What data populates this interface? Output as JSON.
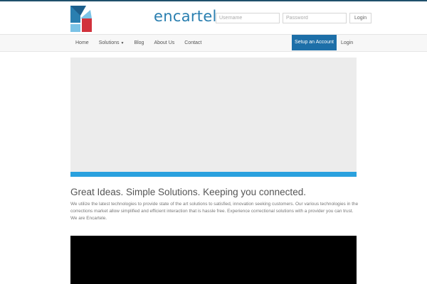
{
  "brand": {
    "name_en": "en",
    "name_rest": "cartele",
    "color_blue": "#2a7fb0",
    "color_red": "#d1323c",
    "color_light": "#7bc3e6"
  },
  "auth": {
    "username_placeholder": "Username",
    "password_placeholder": "Password",
    "login_button": "Login"
  },
  "nav": {
    "items": [
      "Home",
      "Solutions",
      "Blog",
      "About Us",
      "Contact"
    ],
    "setup_button": "Setup an Account",
    "login_link": "Login"
  },
  "hero": {
    "headline": "Great Ideas. Simple Solutions. Keeping you connected.",
    "intro": "We utilize the latest technologies to provide state of the art solutions to satisfied, innovation seeking customers. Our various technologies in the corrections market allow simplified and efficient interaction that is hassle free. Experience correctional solutions with a provider you can trust. We are Encartele."
  },
  "colors": {
    "accent": "#2aa1de",
    "nav_button": "#1d6fa8"
  }
}
